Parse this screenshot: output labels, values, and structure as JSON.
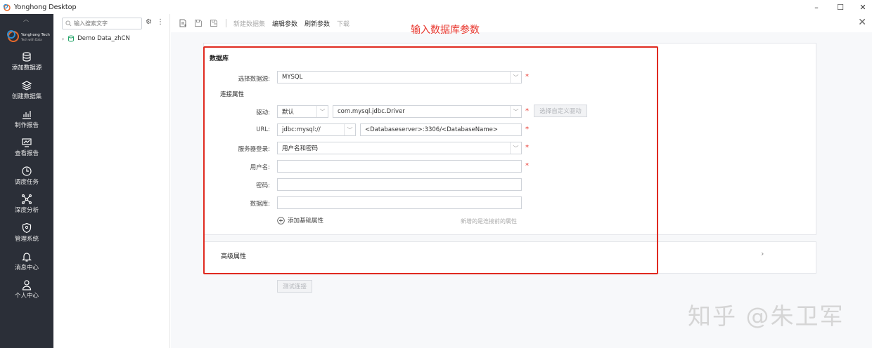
{
  "window": {
    "title": "Yonghong Desktop",
    "controls": {
      "minimize": "–",
      "maximize": "☐",
      "close": "✕"
    }
  },
  "sidebar": {
    "logo_text": "Yonghong Tech",
    "logo_sub": "Tech with Data",
    "items": [
      {
        "label": "添加数据源",
        "icon": "database-icon"
      },
      {
        "label": "创建数据集",
        "icon": "layers-icon"
      },
      {
        "label": "制作报告",
        "icon": "chart-icon"
      },
      {
        "label": "查看报告",
        "icon": "monitor-icon"
      },
      {
        "label": "调度任务",
        "icon": "clock-icon"
      },
      {
        "label": "深度分析",
        "icon": "network-icon"
      },
      {
        "label": "管理系统",
        "icon": "shield-icon"
      },
      {
        "label": "消息中心",
        "icon": "bell-icon"
      },
      {
        "label": "个人中心",
        "icon": "user-icon"
      }
    ]
  },
  "tree": {
    "search_placeholder": "输入搜索文字",
    "items": [
      {
        "label": "Demo Data_zhCN"
      }
    ]
  },
  "toolbar": {
    "new_dataset": "新建数据集",
    "edit_params": "编辑参数",
    "refresh_params": "刷新参数",
    "download": "下载"
  },
  "annotation": "输入数据库参数",
  "form": {
    "section_title": "数据库",
    "datasource_label": "选择数据源:",
    "datasource_value": "MYSQL",
    "conn_props_title": "连接属性",
    "driver_label": "驱动:",
    "driver_mode": "默认",
    "driver_class": "com.mysql.jdbc.Driver",
    "custom_driver_button": "选择自定义驱动",
    "url_label": "URL:",
    "url_prefix": "jdbc:mysql://",
    "url_value": "<Databaseserver>:3306/<DatabaseName>",
    "server_login_label": "服务器登录:",
    "server_login_value": "用户名和密码",
    "username_label": "用户名:",
    "username_value": "",
    "password_label": "密码:",
    "password_value": "",
    "database_label": "数据库:",
    "database_value": "",
    "add_basic_prop": "添加基础属性",
    "add_hint": "新增的是连接前的属性",
    "required_mark": "*"
  },
  "advanced": {
    "title": "高级属性"
  },
  "test_button": "测试连接",
  "watermark": "知乎 @朱卫军",
  "colors": {
    "accent_red": "#e02a20",
    "nav_bg": "#2b2f38"
  }
}
